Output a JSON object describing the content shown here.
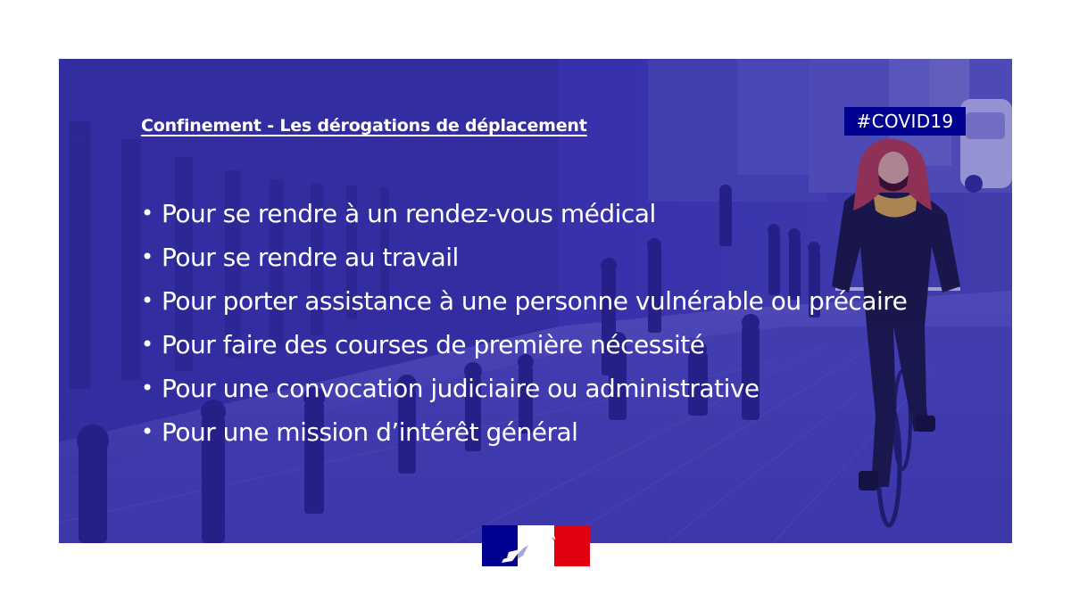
{
  "card": {
    "heading": "Confinement - Les dérogations de déplacement",
    "hashtag": "#COVID19",
    "items": [
      "Pour se rendre à un rendez-vous médical",
      "Pour se rendre au travail",
      "Pour porter assistance à une personne vulnérable ou précaire",
      "Pour faire des courses de première nécessité",
      "Pour une convocation judiciaire ou administrative",
      "Pour une mission d’intérêt général"
    ],
    "bullet": "•"
  },
  "colors": {
    "overlay_blue": "#3a34a8",
    "badge_blue": "#000091",
    "flag_blue": "#000091",
    "flag_red": "#e1000f",
    "text": "#ffffff"
  },
  "icons": {
    "logo": "marianne-logo-icon"
  }
}
